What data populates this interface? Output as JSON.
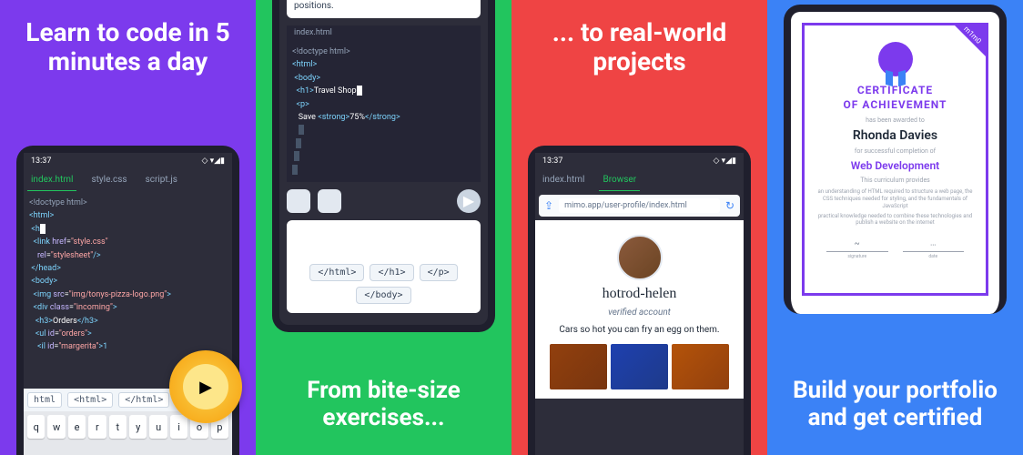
{
  "panel1": {
    "headline": "Learn to code in 5 minutes a day",
    "time": "13:37",
    "tabs": [
      "index.html",
      "style.css",
      "script.js"
    ],
    "code": {
      "l1": "<!doctype html>",
      "l2a": "<",
      "l2b": "html",
      "l2c": ">",
      "l3a": "<",
      "l3b": "h",
      "l4a": "<",
      "l4b": "link ",
      "l4c": "href",
      "l4d": "=",
      "l4e": "\"style.css\"",
      "l5a": "rel",
      "l5b": "=",
      "l5c": "\"stylesheet\"",
      "l5d": "/>",
      "l6a": "</",
      "l6b": "head",
      "l6c": ">",
      "l7a": "<",
      "l7b": "body",
      "l7c": ">",
      "l8a": "<",
      "l8b": "img ",
      "l8c": "src",
      "l8d": "=",
      "l8e": "\"img/tonys-pizza-logo.png\"",
      "l8f": ">",
      "l9a": "<",
      "l9b": "div ",
      "l9c": "class",
      "l9d": "=",
      "l9e": "\"incoming\"",
      "l9f": ">",
      "l10a": "<",
      "l10b": "h3",
      "l10c": ">",
      "l10d": "Orders",
      "l10e": "</",
      "l10f": "h3",
      "l10g": ">",
      "l11a": "<",
      "l11b": "ul ",
      "l11c": "id",
      "l11d": "=",
      "l11e": "\"orders\"",
      "l11f": ">",
      "l12a": "<",
      "l12b": "il ",
      "l12c": "id",
      "l12d": "=",
      "l12e": "\"margerita\"",
      "l12f": ">1"
    },
    "hints": [
      "html",
      "<html>",
      "</html>"
    ],
    "keys": [
      "q",
      "w",
      "e",
      "r",
      "t",
      "y",
      "u",
      "i",
      "o",
      "p"
    ]
  },
  "panel2": {
    "tagline": "From bite-size exercises...",
    "filename": "index.html",
    "exercise": "positions.",
    "code": {
      "l1": "<!doctype html>",
      "l2a": "<",
      "l2b": "html",
      "l2c": ">",
      "l3a": "<",
      "l3b": "body",
      "l3c": ">",
      "l4a": "<",
      "l4b": "h1",
      "l4c": ">",
      "l4d": "Travel Shop",
      "l5a": "<",
      "l5b": "p",
      "l5c": ">",
      "l6a": "Save ",
      "l6b": "<",
      "l6c": "strong",
      "l6d": ">",
      "l6e": "75%",
      "l6f": "</",
      "l6g": "strong",
      "l6h": ">"
    },
    "chips": [
      "</html>",
      "</h1>",
      "</p>",
      "</body>"
    ]
  },
  "panel3": {
    "headline": "... to real-world projects",
    "time": "13:37",
    "tabs": [
      "index.html",
      "Browser"
    ],
    "url": "mimo.app/user-profile/index.html",
    "profile": {
      "name": "hotrod-helen",
      "verified": "verified account",
      "bio": "Cars so hot you can fry an egg on them."
    }
  },
  "panel4": {
    "tagline": "Build your portfolio and get certified",
    "cert": {
      "badge": "m1m0",
      "title1": "CERTIFICATE",
      "title2": "OF ACHIEVEMENT",
      "sub1": "has been awarded to",
      "name": "Rhonda Davies",
      "sub2": "for successful completion of",
      "course": "Web Development",
      "sub3": "This curriculum provides",
      "tiny1": "an understanding of HTML required to structure a web page, the CSS techniques needed for styling, and the fundamentals of JavaScript",
      "tiny2": "practical knowledge needed to combine these technologies and publish a website on the internet"
    }
  }
}
